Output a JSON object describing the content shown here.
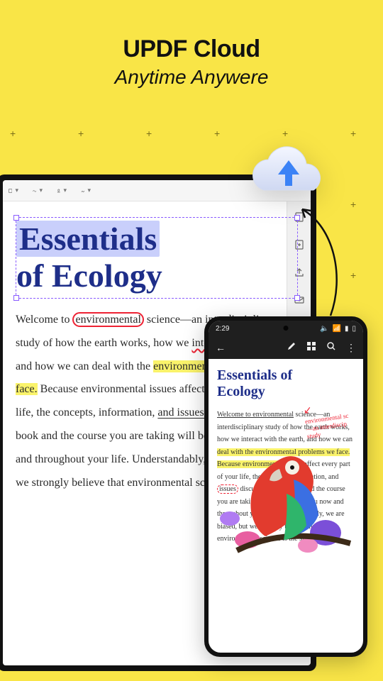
{
  "header": {
    "title": "UPDF Cloud",
    "subtitle": "Anytime Anywere"
  },
  "tablet": {
    "doc_title_line1": "Essentials",
    "doc_title_line2": "of Ecology",
    "body_pre": "Welcome to ",
    "body_env": "environmental",
    "body_after_env": " science—an interdisciplinary study of how the earth works, how we ",
    "body_interact": "interact with the earth,",
    "body_after_interact": " and how we can deal with the ",
    "body_problems": "environmental problems we face.",
    "body_after_problems": " Because environmental issues affect every part of your life, the concepts, information, ",
    "body_issues": "and issues discussed in",
    "body_tail": " this book and the course you are taking will be useful to you now and throughout your life. Understandably, we are biased, but we strongly believe that environmental science is the single"
  },
  "phone": {
    "time": "2:29",
    "title_line1": "Essentials of",
    "title_line2": "Ecology",
    "hand_note_l1": "environmental sc",
    "hand_note_l2": "—an interdiscip",
    "hand_note_l3": "study",
    "body_intro": "Welcome to environmental",
    "body_after_intro": " science—an interdisciplinary study of how the earth works, how we interact with the earth, and how we can ",
    "body_yellow1": "deal with the environmental problems we face. Because environmental",
    "body_after_yellow1": " issues affect every part of your life, the concepts, information, and ",
    "body_issues": "issues",
    "body_after_issues": " discussed in this book and the course you are taking will be useful to you now and throughout your life. Understandably, we are biased, but we strongly believe that environmental science is the single most in"
  }
}
